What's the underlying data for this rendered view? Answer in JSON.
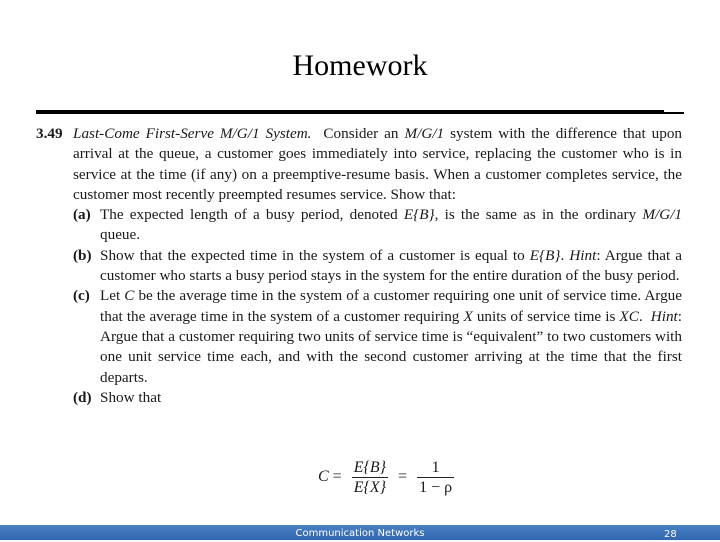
{
  "slide": {
    "title": "Homework",
    "footer": "Communication Networks",
    "page_number": "28"
  },
  "problem": {
    "number": "3.49",
    "heading_italic": "Last-Come First-Serve",
    "heading_math": "M/G/1",
    "heading_suffix": "System.",
    "intro_1": "Consider an",
    "intro_math": "M/G/1",
    "intro_2": "system with the difference that upon arrival at the queue, a customer goes immediately into service, replacing the customer who is in service at the time (if any) on a preemptive-resume basis.  When a customer completes service, the customer most recently preempted resumes service.  Show that:",
    "parts": [
      {
        "label": "(a)",
        "t1": "The expected length of a busy period, denoted",
        "m1": "E{B}",
        "t2": ", is the same as in the ordinary",
        "m2": "M/G/1",
        "t3": "queue."
      },
      {
        "label": "(b)",
        "t1": "Show that the expected time in the system of a customer is equal to",
        "m1": "E{B}",
        "t2": ".",
        "hint": "Hint",
        "t3": ": Argue that a customer who starts a busy period stays in the system for the entire duration of the busy period."
      },
      {
        "label": "(c)",
        "t1": "Let",
        "m1": "C",
        "t2": "be the average time in the system of a customer requiring one unit of service time.  Argue that the average time in the system of a customer requiring",
        "m2": "X",
        "t3": "units of service time is",
        "m3": "XC",
        "t4": ".",
        "hint": "Hint",
        "t5": ": Argue that a customer requiring two units of service time is “equivalent” to two customers with one unit service time each, and with the second customer arriving at the time that the first departs."
      },
      {
        "label": "(d)",
        "t1": "Show that"
      }
    ],
    "formula": {
      "lhs": "C",
      "eq": "=",
      "num1": "E{B}",
      "den1": "E{X}",
      "num2": "1",
      "den2": "1 − ρ"
    }
  }
}
